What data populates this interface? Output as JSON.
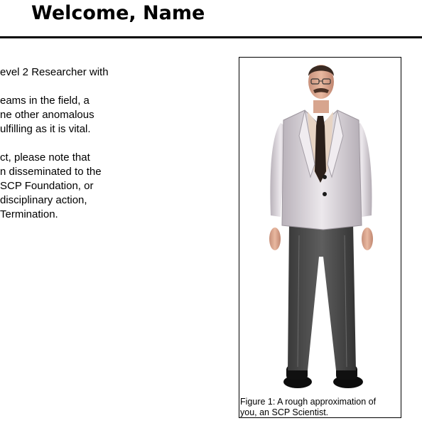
{
  "header": {
    "title": "Welcome, Name"
  },
  "body": {
    "paragraphs": [
      [
        "evel 2 Researcher with"
      ],
      [
        "eams in the field, a",
        "ne other anomalous",
        "ulfilling as it is vital."
      ],
      [
        "ct, please note that",
        "n disseminated to the",
        " SCP Foundation, or",
        "disciplinary action,",
        "Termination."
      ]
    ]
  },
  "figure": {
    "caption_line1": "Figure 1: A rough approximation of",
    "caption_line2": "you, an SCP Scientist."
  },
  "colors": {
    "text": "#000000",
    "background": "#ffffff",
    "coat": "#dcd6dc",
    "trousers": "#4a4a4a",
    "tie": "#2a1f1a"
  }
}
